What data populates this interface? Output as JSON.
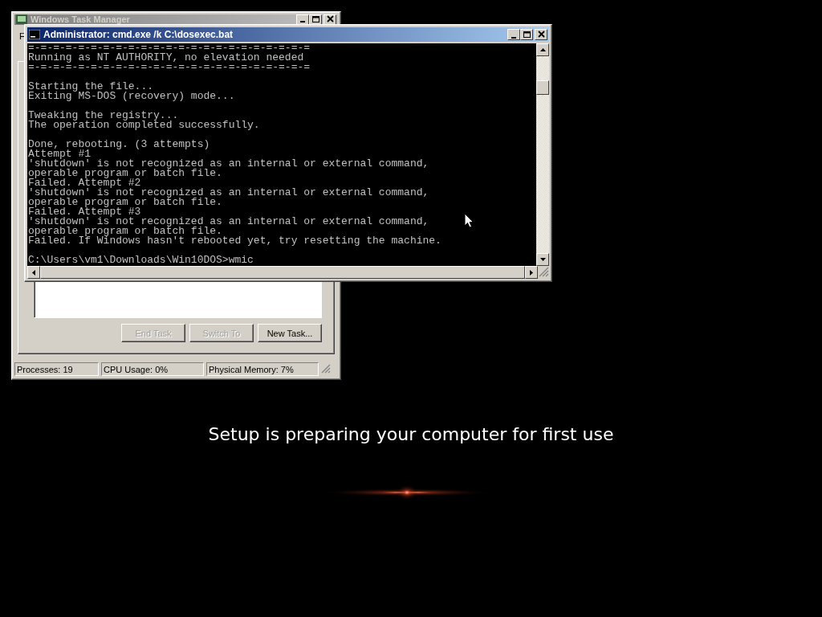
{
  "task_manager": {
    "title": "Windows Task Manager",
    "active": false,
    "menu": [
      "F"
    ],
    "buttons": [
      {
        "label": "End Task",
        "disabled": true
      },
      {
        "label": "Switch To",
        "disabled": true
      },
      {
        "label": "New Task...",
        "disabled": false
      }
    ],
    "status_bar": [
      "Processes: 19",
      "CPU Usage: 0%",
      "Physical Memory: 7%"
    ]
  },
  "console_window": {
    "title": "Administrator: cmd.exe /k C:\\dosexec.bat",
    "active": true,
    "blocks": [
      [
        "=-=-=-=-=-=-=-=-=-=-=-=-=-=-=-=-=-=-=-=-=-=-=",
        "Running as NT AUTHORITY, no elevation needed",
        "=-=-=-=-=-=-=-=-=-=-=-=-=-=-=-=-=-=-=-=-=-=-="
      ],
      [
        "Starting the file...",
        "Exiting MS-DOS (recovery) mode..."
      ],
      [
        "Tweaking the registry...",
        "The operation completed successfully."
      ],
      [
        "Done, rebooting. (3 attempts)",
        "Attempt #1",
        "'shutdown' is not recognized as an internal or external command,",
        "operable program or batch file.",
        "Failed. Attempt #2",
        "'shutdown' is not recognized as an internal or external command,",
        "operable program or batch file.",
        "Failed. Attempt #3",
        "'shutdown' is not recognized as an internal or external command,",
        "operable program or batch file.",
        "Failed. If Windows hasn't rebooted yet, try resetting the machine."
      ],
      [
        "C:\\Users\\vm1\\Downloads\\Win10DOS>wmic"
      ]
    ]
  },
  "setup_message": "Setup is preparing your computer for first use"
}
